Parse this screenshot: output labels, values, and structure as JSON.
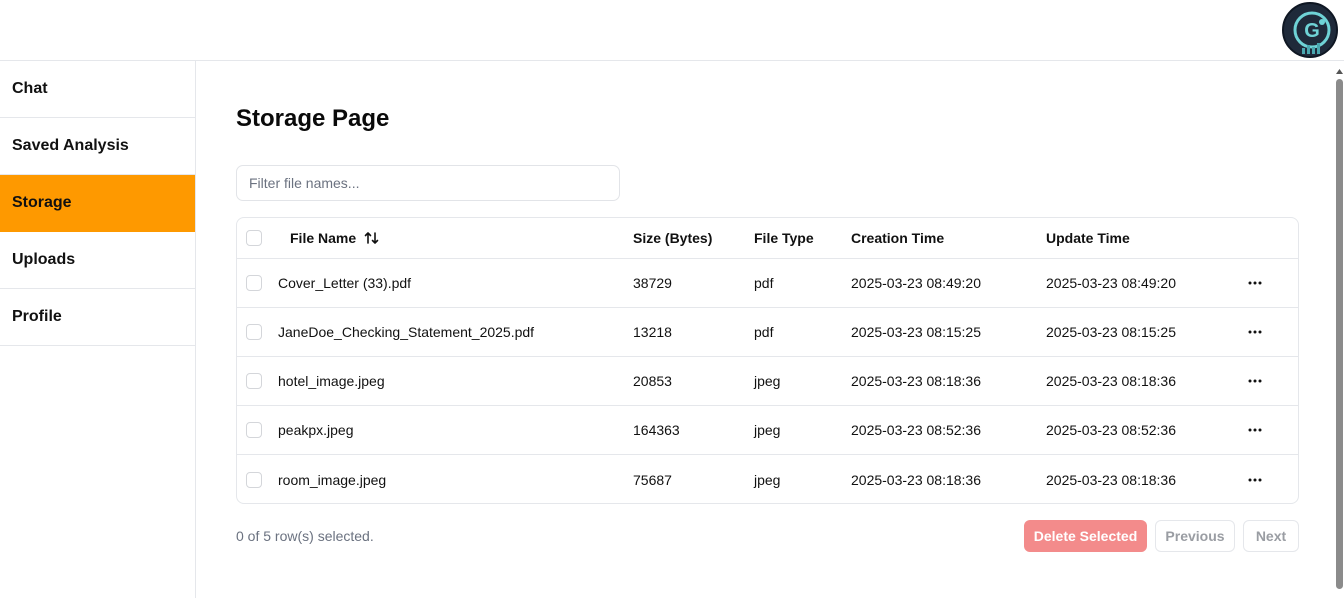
{
  "sidebar": {
    "items": [
      {
        "label": "Chat"
      },
      {
        "label": "Saved Analysis"
      },
      {
        "label": "Storage"
      },
      {
        "label": "Uploads"
      },
      {
        "label": "Profile"
      }
    ],
    "active": "Storage"
  },
  "page": {
    "title": "Storage Page"
  },
  "filter": {
    "placeholder": "Filter file names...",
    "value": ""
  },
  "table": {
    "headers": {
      "name": "File Name",
      "size": "Size (Bytes)",
      "type": "File Type",
      "created": "Creation Time",
      "updated": "Update Time"
    },
    "rows": [
      {
        "name": "Cover_Letter (33).pdf",
        "size": "38729",
        "type": "pdf",
        "created": "2025-03-23 08:49:20",
        "updated": "2025-03-23 08:49:20"
      },
      {
        "name": "JaneDoe_Checking_Statement_2025.pdf",
        "size": "13218",
        "type": "pdf",
        "created": "2025-03-23 08:15:25",
        "updated": "2025-03-23 08:15:25"
      },
      {
        "name": "hotel_image.jpeg",
        "size": "20853",
        "type": "jpeg",
        "created": "2025-03-23 08:18:36",
        "updated": "2025-03-23 08:18:36"
      },
      {
        "name": "peakpx.jpeg",
        "size": "164363",
        "type": "jpeg",
        "created": "2025-03-23 08:52:36",
        "updated": "2025-03-23 08:52:36"
      },
      {
        "name": "room_image.jpeg",
        "size": "75687",
        "type": "jpeg",
        "created": "2025-03-23 08:18:36",
        "updated": "2025-03-23 08:18:36"
      }
    ]
  },
  "footer": {
    "status": "0 of 5 row(s) selected.",
    "delete_label": "Delete Selected",
    "previous_label": "Previous",
    "next_label": "Next"
  },
  "colors": {
    "active_sidebar": "#fe9900",
    "delete_button": "#f38b8b"
  },
  "icons": {
    "avatar": "g-logo-avatar-icon",
    "sort": "sort-arrows-icon",
    "row_menu": "ellipsis-icon"
  }
}
